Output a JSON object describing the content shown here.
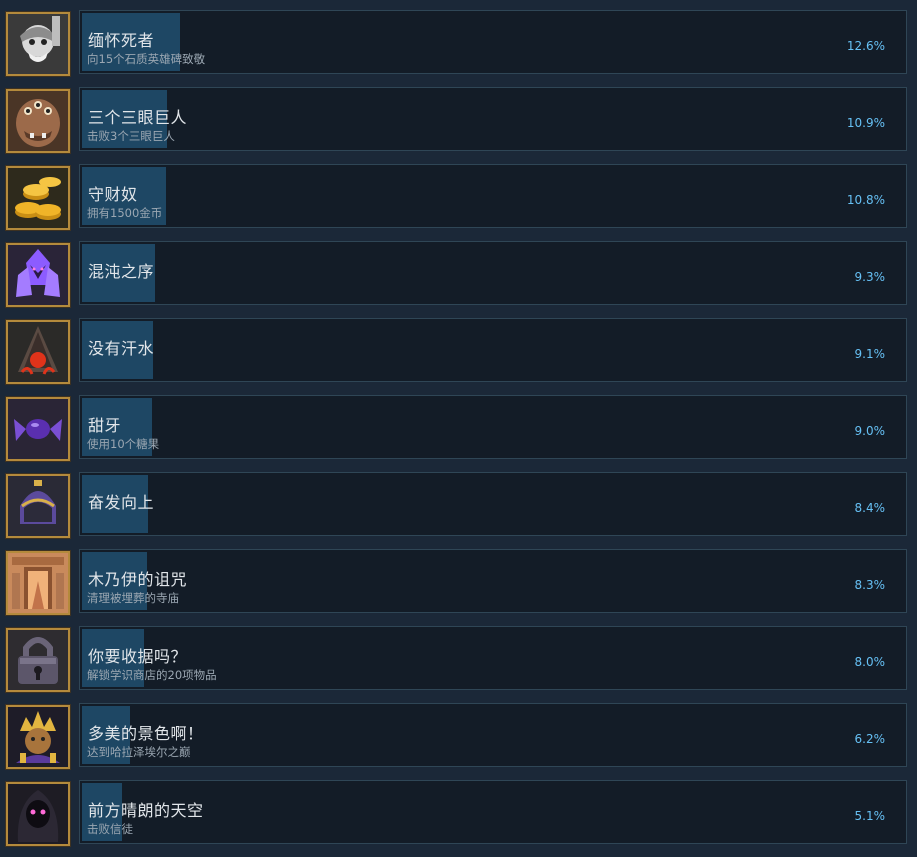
{
  "achievements": [
    {
      "title": "缅怀死者",
      "desc": "向15个石质英雄碑致敬",
      "percent": "12.6%",
      "fraction": 0.126,
      "icon": "stone-hero-icon"
    },
    {
      "title": "三个三眼巨人",
      "desc": "击败3个三眼巨人",
      "percent": "10.9%",
      "fraction": 0.109,
      "icon": "three-eyed-giant-icon"
    },
    {
      "title": "守财奴",
      "desc": "拥有1500金币",
      "percent": "10.8%",
      "fraction": 0.108,
      "icon": "gold-coins-icon"
    },
    {
      "title": "混沌之序",
      "desc": "",
      "percent": "9.3%",
      "fraction": 0.093,
      "icon": "purple-crystal-icon"
    },
    {
      "title": "没有汗水",
      "desc": "",
      "percent": "9.1%",
      "fraction": 0.091,
      "icon": "hooded-flame-icon"
    },
    {
      "title": "甜牙",
      "desc": "使用10个糖果",
      "percent": "9.0%",
      "fraction": 0.09,
      "icon": "candy-icon"
    },
    {
      "title": "奋发向上",
      "desc": "",
      "percent": "8.4%",
      "fraction": 0.084,
      "icon": "helmet-icon"
    },
    {
      "title": "木乃伊的诅咒",
      "desc": "清理被埋葬的寺庙",
      "percent": "8.3%",
      "fraction": 0.083,
      "icon": "temple-door-icon"
    },
    {
      "title": "你要收据吗？",
      "desc": "解锁学识商店的20项物品",
      "percent": "8.0%",
      "fraction": 0.08,
      "icon": "padlock-icon"
    },
    {
      "title": "多美的景色啊！",
      "desc": "达到哈拉泽埃尔之巅",
      "percent": "6.2%",
      "fraction": 0.062,
      "icon": "crowned-king-icon"
    },
    {
      "title": "前方晴朗的天空",
      "desc": "击败信徒",
      "percent": "5.1%",
      "fraction": 0.051,
      "icon": "hooded-cultist-icon"
    }
  ],
  "colors": {
    "background": "#1b2838",
    "progress_fill": "#1e4764",
    "percent_text": "#66c0f4",
    "icon_frame": "#b48a3c"
  }
}
